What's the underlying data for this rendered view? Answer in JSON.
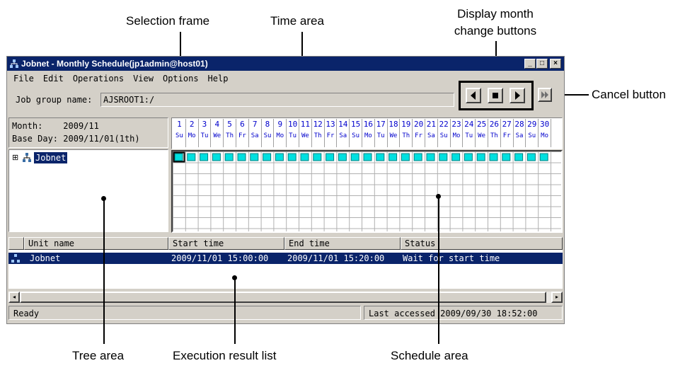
{
  "callouts": {
    "selection_frame": "Selection frame",
    "time_area": "Time area",
    "display_month_change_buttons": [
      "Display month",
      "change buttons"
    ],
    "cancel_button": "Cancel button",
    "tree_area": "Tree area",
    "execution_result_list": "Execution result list",
    "schedule_area": "Schedule area"
  },
  "window": {
    "title": "Jobnet - Monthly Schedule(jp1admin@host01)",
    "controls": [
      "_",
      "□",
      "×"
    ]
  },
  "menu": [
    "File",
    "Edit",
    "Operations",
    "View",
    "Options",
    "Help"
  ],
  "job_group": {
    "label": "Job group name:",
    "value": "AJSROOT1:/"
  },
  "info": {
    "month_label": "Month:",
    "month_value": "2009/11",
    "base_day_label": "Base Day:",
    "base_day_value": "2009/11/01(1th)"
  },
  "tree": {
    "expander": "⊞",
    "item": "Jobnet"
  },
  "calendar": {
    "days": [
      "1",
      "2",
      "3",
      "4",
      "5",
      "6",
      "7",
      "8",
      "9",
      "10",
      "11",
      "12",
      "13",
      "14",
      "15",
      "16",
      "17",
      "18",
      "19",
      "20",
      "21",
      "22",
      "23",
      "24",
      "25",
      "26",
      "27",
      "28",
      "29",
      "30"
    ],
    "weekdays": [
      "Su",
      "Mo",
      "Tu",
      "We",
      "Th",
      "Fr",
      "Sa",
      "Su",
      "Mo",
      "Tu",
      "We",
      "Th",
      "Fr",
      "Sa",
      "Su",
      "Mo",
      "Tu",
      "We",
      "Th",
      "Fr",
      "Sa",
      "Su",
      "Mo",
      "Tu",
      "We",
      "Th",
      "Fr",
      "Sa",
      "Su",
      "Mo"
    ],
    "schedule_color": "#00e0e0"
  },
  "list": {
    "columns": [
      "Unit name",
      "Start time",
      "End time",
      "Status"
    ],
    "rows": [
      {
        "unit": "Jobnet",
        "start": "2009/11/01 15:00:00",
        "end": "2009/11/01 15:20:00",
        "status": "Wait for start time"
      }
    ]
  },
  "status": {
    "left": "Ready",
    "right": "Last accessed 2009/09/30 18:52:00"
  },
  "icons": {
    "nav": [
      "previous-month-icon",
      "current-month-icon",
      "next-month-icon"
    ],
    "cancel": "cancel-icon",
    "jobnet": "jobnet-icon"
  }
}
